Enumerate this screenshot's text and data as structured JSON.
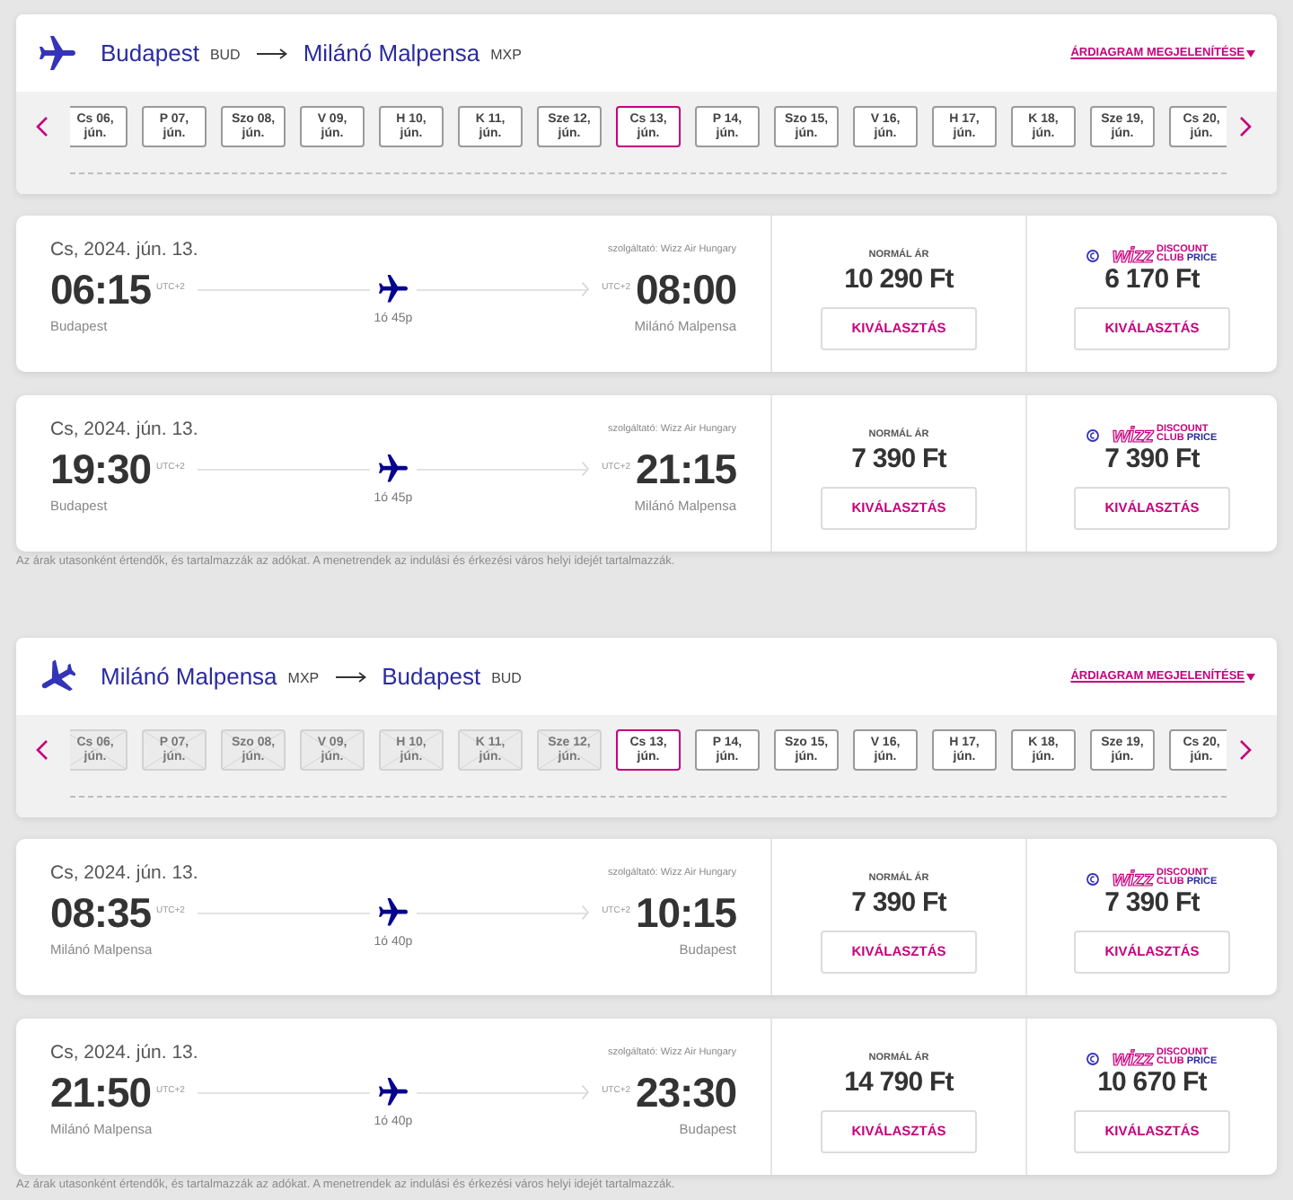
{
  "sections": [
    {
      "kind": "outbound",
      "route": {
        "from_city": "Budapest",
        "from_code": "BUD",
        "to_city": "Milánó Malpensa",
        "to_code": "MXP"
      },
      "price_chart_link": "ÁRDIAGRAM MEGJELENÍTÉSE",
      "dates": [
        {
          "lines": [
            "Cs 06,",
            "jún."
          ],
          "selected": false,
          "disabled": false
        },
        {
          "lines": [
            "P 07,",
            "jún."
          ],
          "selected": false,
          "disabled": false
        },
        {
          "lines": [
            "Szo 08,",
            "jún."
          ],
          "selected": false,
          "disabled": false
        },
        {
          "lines": [
            "V 09,",
            "jún."
          ],
          "selected": false,
          "disabled": false
        },
        {
          "lines": [
            "H 10,",
            "jún."
          ],
          "selected": false,
          "disabled": false
        },
        {
          "lines": [
            "K 11,",
            "jún."
          ],
          "selected": false,
          "disabled": false
        },
        {
          "lines": [
            "Sze 12,",
            "jún."
          ],
          "selected": false,
          "disabled": false
        },
        {
          "lines": [
            "Cs 13,",
            "jún."
          ],
          "selected": true,
          "disabled": false
        },
        {
          "lines": [
            "P 14,",
            "jún."
          ],
          "selected": false,
          "disabled": false
        },
        {
          "lines": [
            "Szo 15,",
            "jún."
          ],
          "selected": false,
          "disabled": false
        },
        {
          "lines": [
            "V 16,",
            "jún."
          ],
          "selected": false,
          "disabled": false
        },
        {
          "lines": [
            "H 17,",
            "jún."
          ],
          "selected": false,
          "disabled": false
        },
        {
          "lines": [
            "K 18,",
            "jún."
          ],
          "selected": false,
          "disabled": false
        },
        {
          "lines": [
            "Sze 19,",
            "jún."
          ],
          "selected": false,
          "disabled": false
        },
        {
          "lines": [
            "Cs 20,",
            "jún."
          ],
          "selected": false,
          "disabled": false
        }
      ],
      "flights": [
        {
          "date": "Cs, 2024. jún. 13.",
          "operator": "szolgáltató: Wizz Air Hungary",
          "departure_time": "06:15",
          "departure_tz": "UTC+2",
          "arrival_tz": "UTC+2",
          "arrival_time": "08:00",
          "departure_city": "Budapest",
          "duration": "1ó 45p",
          "arrival_city": "Milánó Malpensa",
          "fares": [
            {
              "kind": "normal",
              "label": "NORMÁL ÁR",
              "price": "10 290 Ft",
              "button": "KIVÁLASZTÁS"
            },
            {
              "kind": "discount_club",
              "logo": {
                "brand": "wizz",
                "words": [
                  "DISCOUNT",
                  "CLUB",
                  "PRICE"
                ]
              },
              "price": "6 170 Ft",
              "button": "KIVÁLASZTÁS"
            }
          ]
        },
        {
          "date": "Cs, 2024. jún. 13.",
          "operator": "szolgáltató: Wizz Air Hungary",
          "departure_time": "19:30",
          "departure_tz": "UTC+2",
          "arrival_tz": "UTC+2",
          "arrival_time": "21:15",
          "departure_city": "Budapest",
          "duration": "1ó 45p",
          "arrival_city": "Milánó Malpensa",
          "fares": [
            {
              "kind": "normal",
              "label": "NORMÁL ÁR",
              "price": "7 390 Ft",
              "button": "KIVÁLASZTÁS"
            },
            {
              "kind": "discount_club",
              "logo": {
                "brand": "wizz",
                "words": [
                  "DISCOUNT",
                  "CLUB",
                  "PRICE"
                ]
              },
              "price": "7 390 Ft",
              "button": "KIVÁLASZTÁS"
            }
          ]
        }
      ],
      "footnote": "Az árak utasonként értendők, és tartalmazzák az adókat. A menetrendek az indulási és érkezési város helyi idejét tartalmazzák."
    },
    {
      "kind": "return",
      "route": {
        "from_city": "Milánó Malpensa",
        "from_code": "MXP",
        "to_city": "Budapest",
        "to_code": "BUD"
      },
      "price_chart_link": "ÁRDIAGRAM MEGJELENÍTÉSE",
      "dates": [
        {
          "lines": [
            "Cs 06,",
            "jún."
          ],
          "selected": false,
          "disabled": true
        },
        {
          "lines": [
            "P 07,",
            "jún."
          ],
          "selected": false,
          "disabled": true
        },
        {
          "lines": [
            "Szo 08,",
            "jún."
          ],
          "selected": false,
          "disabled": true
        },
        {
          "lines": [
            "V 09,",
            "jún."
          ],
          "selected": false,
          "disabled": true
        },
        {
          "lines": [
            "H 10,",
            "jún."
          ],
          "selected": false,
          "disabled": true
        },
        {
          "lines": [
            "K 11,",
            "jún."
          ],
          "selected": false,
          "disabled": true
        },
        {
          "lines": [
            "Sze 12,",
            "jún."
          ],
          "selected": false,
          "disabled": true
        },
        {
          "lines": [
            "Cs 13,",
            "jún."
          ],
          "selected": true,
          "disabled": false
        },
        {
          "lines": [
            "P 14,",
            "jún."
          ],
          "selected": false,
          "disabled": false
        },
        {
          "lines": [
            "Szo 15,",
            "jún."
          ],
          "selected": false,
          "disabled": false
        },
        {
          "lines": [
            "V 16,",
            "jún."
          ],
          "selected": false,
          "disabled": false
        },
        {
          "lines": [
            "H 17,",
            "jún."
          ],
          "selected": false,
          "disabled": false
        },
        {
          "lines": [
            "K 18,",
            "jún."
          ],
          "selected": false,
          "disabled": false
        },
        {
          "lines": [
            "Sze 19,",
            "jún."
          ],
          "selected": false,
          "disabled": false
        },
        {
          "lines": [
            "Cs 20,",
            "jún."
          ],
          "selected": false,
          "disabled": false
        }
      ],
      "flights": [
        {
          "date": "Cs, 2024. jún. 13.",
          "operator": "szolgáltató: Wizz Air Hungary",
          "departure_time": "08:35",
          "departure_tz": "UTC+2",
          "arrival_tz": "UTC+2",
          "arrival_time": "10:15",
          "departure_city": "Milánó Malpensa",
          "duration": "1ó 40p",
          "arrival_city": "Budapest",
          "fares": [
            {
              "kind": "normal",
              "label": "NORMÁL ÁR",
              "price": "7 390 Ft",
              "button": "KIVÁLASZTÁS"
            },
            {
              "kind": "discount_club",
              "logo": {
                "brand": "wizz",
                "words": [
                  "DISCOUNT",
                  "CLUB",
                  "PRICE"
                ]
              },
              "price": "7 390 Ft",
              "button": "KIVÁLASZTÁS"
            }
          ]
        },
        {
          "date": "Cs, 2024. jún. 13.",
          "operator": "szolgáltató: Wizz Air Hungary",
          "departure_time": "21:50",
          "departure_tz": "UTC+2",
          "arrival_tz": "UTC+2",
          "arrival_time": "23:30",
          "departure_city": "Milánó Malpensa",
          "duration": "1ó 40p",
          "arrival_city": "Budapest",
          "fares": [
            {
              "kind": "normal",
              "label": "NORMÁL ÁR",
              "price": "14 790 Ft",
              "button": "KIVÁLASZTÁS"
            },
            {
              "kind": "discount_club",
              "logo": {
                "brand": "wizz",
                "words": [
                  "DISCOUNT",
                  "CLUB",
                  "PRICE"
                ]
              },
              "price": "10 670 Ft",
              "button": "KIVÁLASZTÁS"
            }
          ]
        }
      ],
      "footnote": "Az árak utasonként értendők, és tartalmazzák az adókat. A menetrendek az indulási és érkezési város helyi idejét tartalmazzák."
    }
  ]
}
